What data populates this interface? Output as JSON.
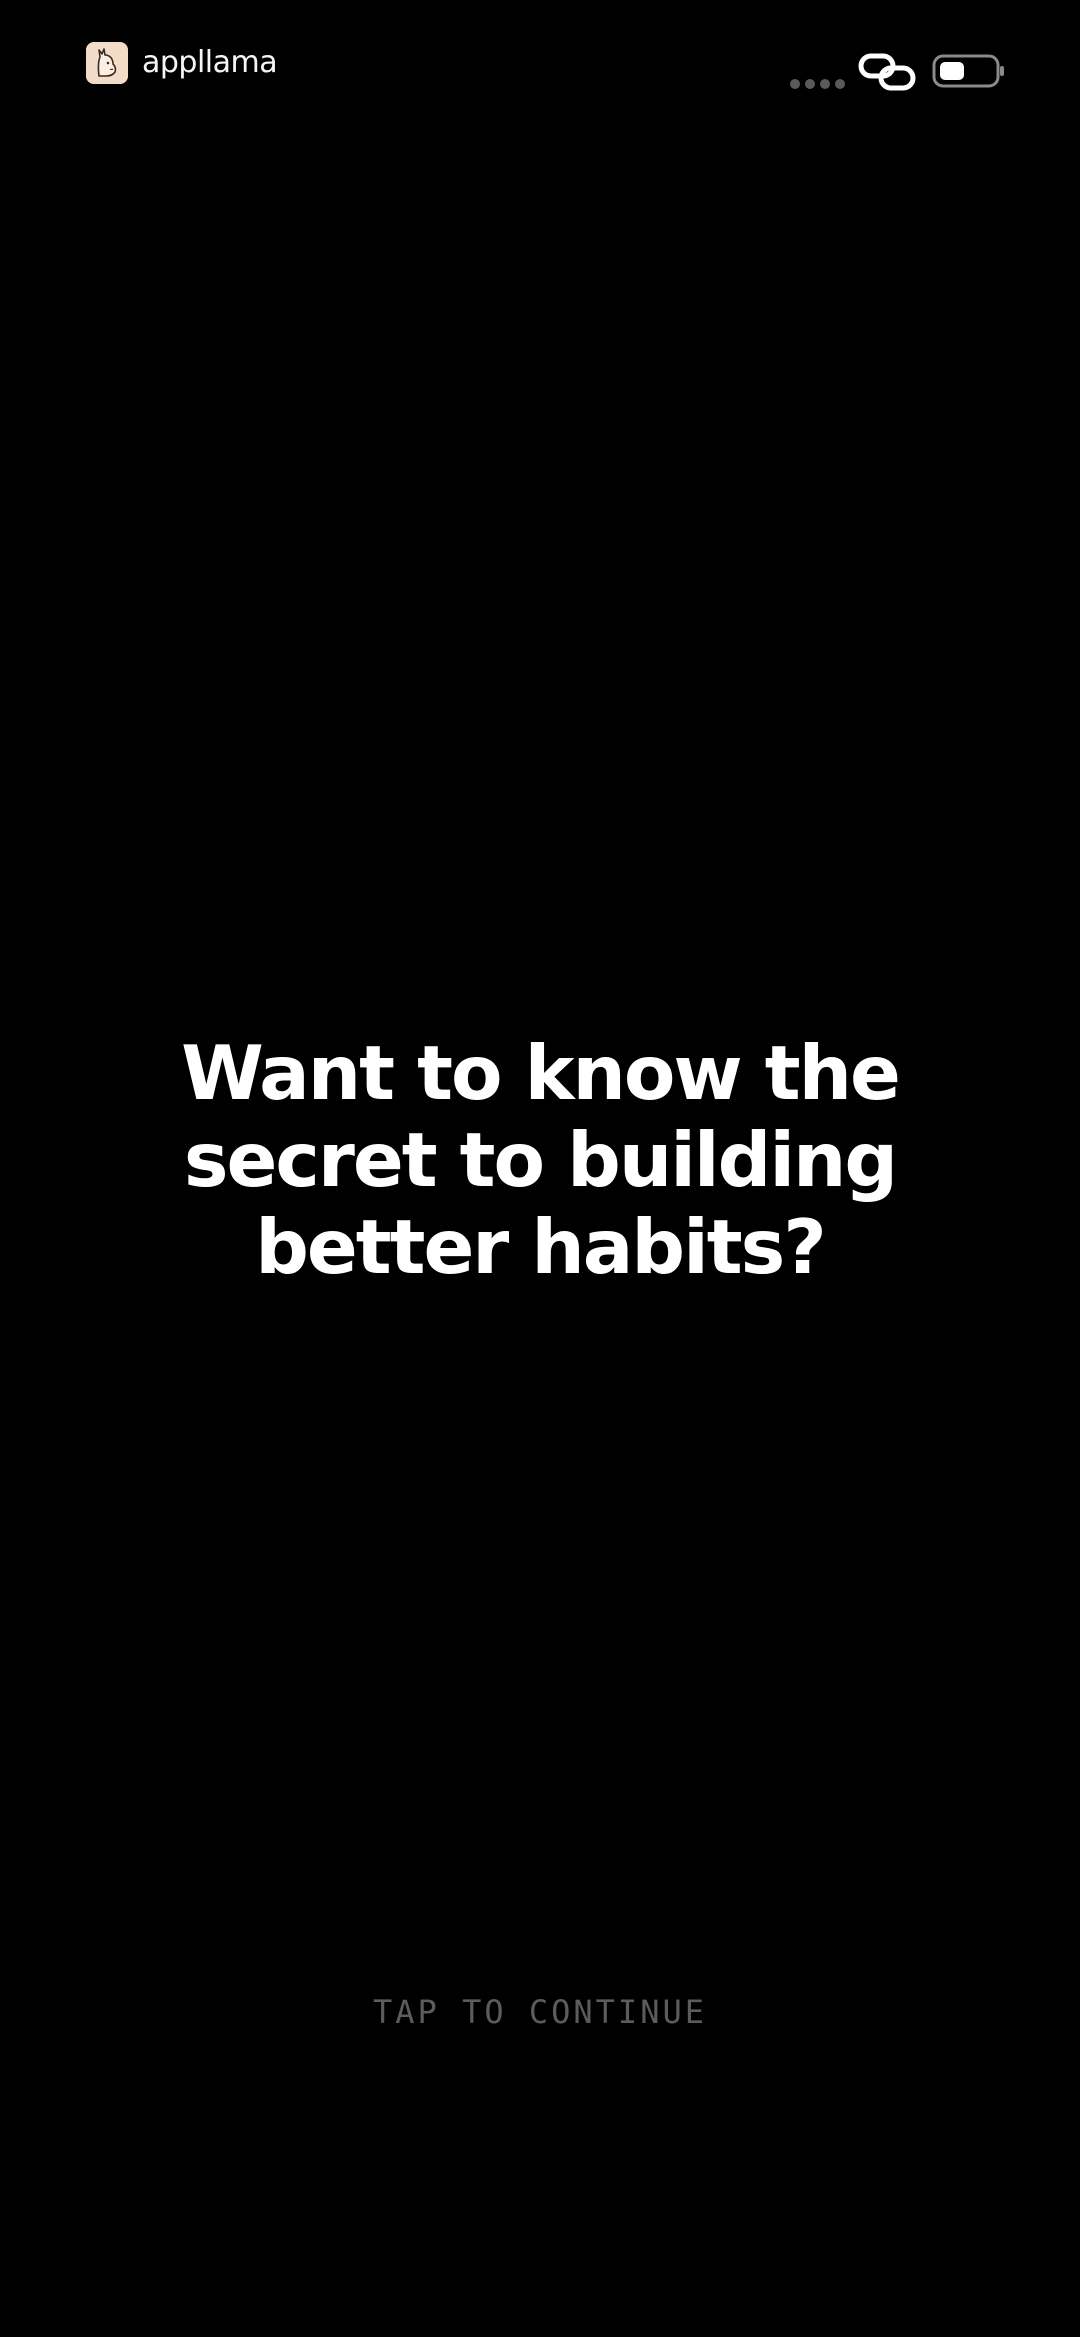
{
  "status_bar": {
    "brand_name": "appllama",
    "icons": [
      "appllama-logo-icon",
      "signal-dots-icon",
      "link-icon",
      "battery-icon"
    ]
  },
  "main": {
    "headline": "Want to know the secret to building better habits?",
    "cta": "TAP TO CONTINUE"
  },
  "colors": {
    "background": "#000000",
    "headline": "#ffffff",
    "cta": "#5c5c5c",
    "logo_bg": "#f3dcc7"
  }
}
